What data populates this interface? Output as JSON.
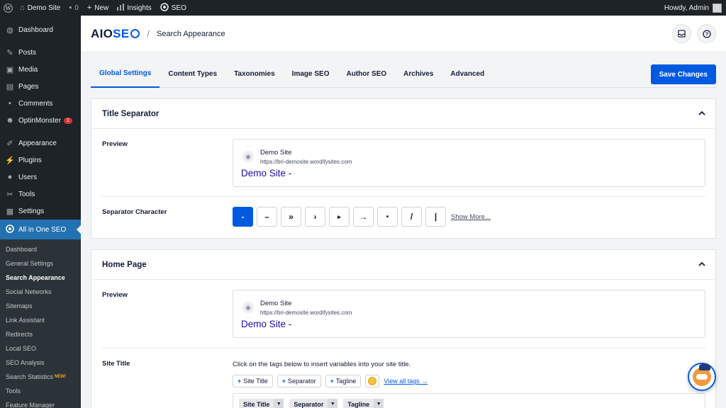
{
  "adminbar": {
    "site": "Demo Site",
    "comments_count": "0",
    "new": "New",
    "insights": "Insights",
    "seo": "SEO",
    "howdy": "Howdy, Admin"
  },
  "sidebar": {
    "items": [
      {
        "label": "Dashboard",
        "icon": "dashboard-icon"
      },
      {
        "label": "Posts",
        "icon": "pin-icon"
      },
      {
        "label": "Media",
        "icon": "media-icon"
      },
      {
        "label": "Pages",
        "icon": "page-icon"
      },
      {
        "label": "Comments",
        "icon": "comment-icon"
      },
      {
        "label": "OptinMonster",
        "icon": "optinmonster-icon",
        "badge": "1"
      },
      {
        "label": "Appearance",
        "icon": "brush-icon"
      },
      {
        "label": "Plugins",
        "icon": "plugin-icon"
      },
      {
        "label": "Users",
        "icon": "user-icon"
      },
      {
        "label": "Tools",
        "icon": "wrench-icon"
      },
      {
        "label": "Settings",
        "icon": "settings-icon"
      },
      {
        "label": "All in One SEO",
        "icon": "aioseo-icon"
      }
    ],
    "submenu": [
      "Dashboard",
      "General Settings",
      "Search Appearance",
      "Social Networks",
      "Sitemaps",
      "Link Assistant",
      "Redirects",
      "Local SEO",
      "SEO Analysis",
      "Search Statistics",
      "Tools",
      "Feature Manager"
    ],
    "new_badge": "NEW!"
  },
  "header": {
    "logo_main": "AIO",
    "logo_accent": "SE",
    "breadcrumb_sep": "/",
    "breadcrumb": "Search Appearance"
  },
  "tabs": [
    "Global Settings",
    "Content Types",
    "Taxonomies",
    "Image SEO",
    "Author SEO",
    "Archives",
    "Advanced"
  ],
  "save_label": "Save Changes",
  "title_separator": {
    "heading": "Title Separator",
    "preview_label": "Preview",
    "preview_site": "Demo Site",
    "preview_url": "https://bri-demosite.wordifysites.com",
    "preview_title": "Demo Site -",
    "separator_label": "Separator Character",
    "separators": [
      "-",
      "–",
      "»",
      "›",
      "▸",
      "→",
      "•",
      "/",
      "|"
    ],
    "show_more": "Show More..."
  },
  "home_page": {
    "heading": "Home Page",
    "preview_label": "Preview",
    "preview_site": "Demo Site",
    "preview_url": "https://bri-demosite.wordifysites.com",
    "preview_title": "Demo Site -",
    "site_title_label": "Site Title",
    "hint": "Click on the tags below to insert variables into your site title.",
    "tags": [
      "Site Title",
      "Separator",
      "Tagline"
    ],
    "view_all": "View all tags →",
    "chips": [
      "Site Title",
      "Separator",
      "Tagline"
    ]
  },
  "colors": {
    "accent": "#005ae0",
    "adminbar": "#1d2327",
    "active_menu": "#2271b1"
  }
}
